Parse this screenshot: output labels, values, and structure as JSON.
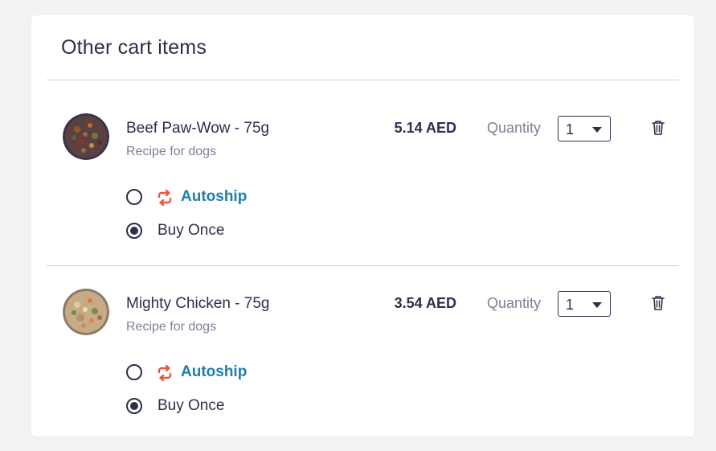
{
  "section": {
    "title": "Other cart items"
  },
  "items": [
    {
      "name": "Beef Paw-Wow - 75g",
      "subtitle": "Recipe for dogs",
      "price": "5.14 AED",
      "quantity_label": "Quantity",
      "quantity_value": "1",
      "image_icon": "beef-food-bowl-image",
      "options": {
        "autoship_label": "Autoship",
        "buy_once_label": "Buy Once",
        "selected": "buy_once"
      }
    },
    {
      "name": "Mighty Chicken - 75g",
      "subtitle": "Recipe for dogs",
      "price": "3.54 AED",
      "quantity_label": "Quantity",
      "quantity_value": "1",
      "image_icon": "chicken-food-bowl-image",
      "options": {
        "autoship_label": "Autoship",
        "buy_once_label": "Buy Once",
        "selected": "buy_once"
      }
    }
  ],
  "colors": {
    "text": "#2b2f4a",
    "muted": "#7c8093",
    "autoship_blue": "#1f7fa8",
    "autoship_icon": "#e5583e"
  }
}
